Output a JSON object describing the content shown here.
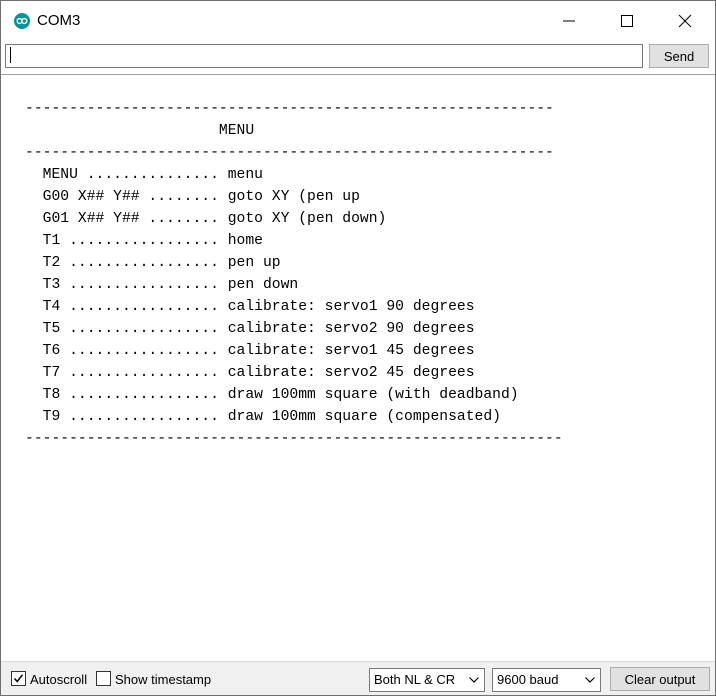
{
  "window": {
    "title": "COM3",
    "accent_color": "#00979c"
  },
  "input": {
    "value": "",
    "send_label": "Send"
  },
  "output": {
    "lines": [
      "------------------------------------------------------------",
      "                      MENU",
      "------------------------------------------------------------",
      "  MENU ............... menu",
      "  G00 X## Y## ........ goto XY (pen up",
      "  G01 X## Y## ........ goto XY (pen down)",
      "  T1 ................. home",
      "  T2 ................. pen up",
      "  T3 ................. pen down",
      "  T4 ................. calibrate: servo1 90 degrees",
      "  T5 ................. calibrate: servo2 90 degrees",
      "  T6 ................. calibrate: servo1 45 degrees",
      "  T7 ................. calibrate: servo2 45 degrees",
      "  T8 ................. draw 100mm square (with deadband)",
      "  T9 ................. draw 100mm square (compensated)",
      "-------------------------------------------------------------"
    ]
  },
  "statusbar": {
    "autoscroll": {
      "label": "Autoscroll",
      "checked": true
    },
    "timestamp": {
      "label": "Show timestamp",
      "checked": false
    },
    "line_ending": "Both NL & CR",
    "baud": "9600 baud",
    "clear_label": "Clear output"
  }
}
